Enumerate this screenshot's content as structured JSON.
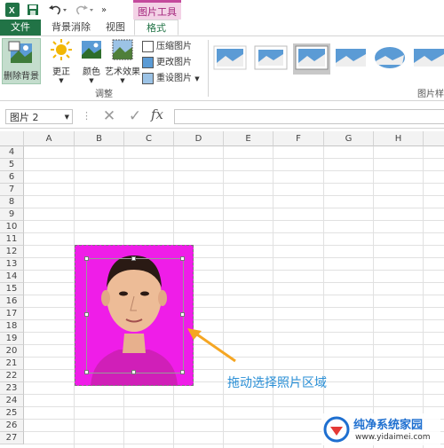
{
  "quick_access": {
    "more": "»"
  },
  "context_tab": {
    "label": "图片工具"
  },
  "tabs": [
    "文件",
    "背景消除",
    "视图",
    "格式"
  ],
  "ribbon": {
    "remove_bg": "删除背景",
    "corrections": "更正",
    "color": "颜色",
    "artistic": "艺术效果",
    "compress": "压缩图片",
    "change": "更改图片",
    "reset": "重设图片",
    "group_adjust": "调整",
    "group_styles": "图片样"
  },
  "formula_bar": {
    "name_box": "图片 2",
    "fx": "fx",
    "cancel": "✕",
    "confirm": "✓"
  },
  "columns": [
    "A",
    "B",
    "C",
    "D",
    "E",
    "F",
    "G",
    "H"
  ],
  "rows": [
    "4",
    "5",
    "6",
    "7",
    "8",
    "9",
    "10",
    "11",
    "12",
    "13",
    "14",
    "15",
    "16",
    "17",
    "18",
    "19",
    "20",
    "21",
    "22",
    "23",
    "24",
    "25",
    "26",
    "27"
  ],
  "annotation": {
    "text": "拖动选择照片区域"
  },
  "watermark": {
    "brand": "纯净系统家园",
    "url": "www.yidaimei.com"
  },
  "colors": {
    "excel_green": "#217346",
    "photo_bg": "#ef1de8",
    "arrow": "#f5a623",
    "caption": "#2a8fd6"
  }
}
